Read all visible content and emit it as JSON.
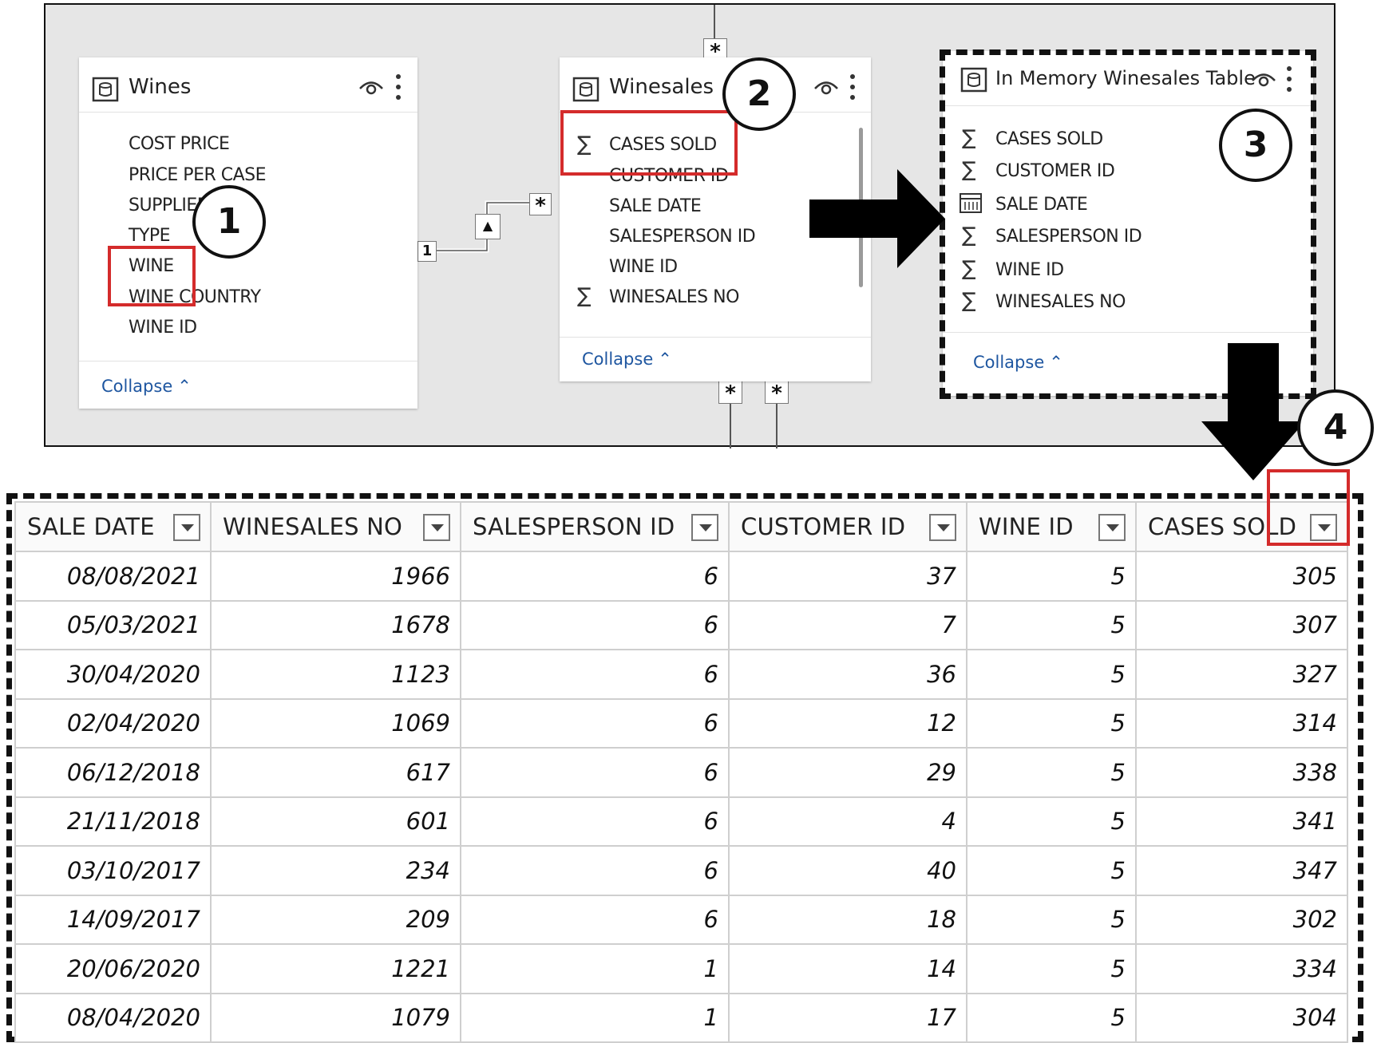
{
  "wines": {
    "title": "Wines",
    "fields": [
      "COST PRICE",
      "PRICE PER CASE",
      "SUPPLIER",
      "TYPE",
      "WINE",
      "WINE COUNTRY",
      "WINE ID"
    ],
    "collapse": "Collapse"
  },
  "winesales": {
    "title": "Winesales",
    "fields": [
      "CASES SOLD",
      "CUSTOMER ID",
      "SALE DATE",
      "SALESPERSON ID",
      "WINE ID",
      "WINESALES NO"
    ],
    "collapse": "Collapse"
  },
  "memory": {
    "title": "In Memory Winesales Table",
    "fields": [
      "CASES SOLD",
      "CUSTOMER ID",
      "SALE DATE",
      "SALESPERSON ID",
      "WINE ID",
      "WINESALES NO"
    ],
    "collapse": "Collapse"
  },
  "relationships": {
    "one": "1",
    "many": "*"
  },
  "callouts": [
    "1",
    "2",
    "3",
    "4"
  ],
  "grid": {
    "columns": [
      "SALE DATE",
      "WINESALES NO",
      "SALESPERSON ID",
      "CUSTOMER ID",
      "WINE ID",
      "CASES SOLD"
    ],
    "rows": [
      [
        "08/08/2021",
        "1966",
        "6",
        "37",
        "5",
        "305"
      ],
      [
        "05/03/2021",
        "1678",
        "6",
        "7",
        "5",
        "307"
      ],
      [
        "30/04/2020",
        "1123",
        "6",
        "36",
        "5",
        "327"
      ],
      [
        "02/04/2020",
        "1069",
        "6",
        "12",
        "5",
        "314"
      ],
      [
        "06/12/2018",
        "617",
        "6",
        "29",
        "5",
        "338"
      ],
      [
        "21/11/2018",
        "601",
        "6",
        "4",
        "5",
        "341"
      ],
      [
        "03/10/2017",
        "234",
        "6",
        "40",
        "5",
        "347"
      ],
      [
        "14/09/2017",
        "209",
        "6",
        "18",
        "5",
        "302"
      ],
      [
        "20/06/2020",
        "1221",
        "1",
        "14",
        "5",
        "334"
      ],
      [
        "08/04/2020",
        "1079",
        "1",
        "17",
        "5",
        "304"
      ]
    ]
  },
  "colors": {
    "highlight": "#d42b2b",
    "link": "#1e56a0"
  }
}
